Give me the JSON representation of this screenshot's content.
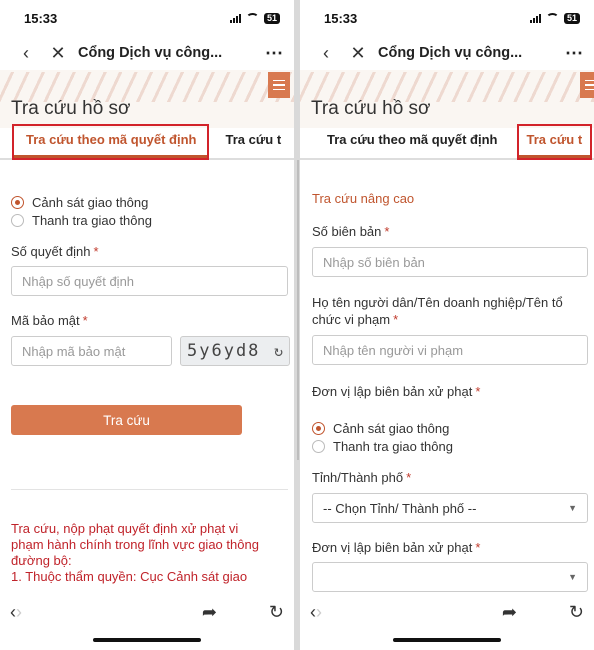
{
  "status": {
    "time": "15:33",
    "battery": "51"
  },
  "nav": {
    "back_icon": "chevron-left-icon",
    "close_icon": "close-icon",
    "title": "Cổng Dịch vụ công...",
    "more": "⋯"
  },
  "page": {
    "title": "Tra cứu hồ sơ"
  },
  "tabs": {
    "by_decision": "Tra cứu theo mã quyết định",
    "other_cut_left": "Tra cứu t",
    "other_cut_right": "Tra cứu t"
  },
  "agency_options": [
    "Cảnh sát giao thông",
    "Thanh tra giao thông"
  ],
  "left_form": {
    "decision_label": "Số quyết định",
    "decision_placeholder": "Nhập số quyết định",
    "security_label": "Mã bảo mật",
    "security_placeholder": "Nhập mã bảo mật",
    "captcha_text": "5y6yd8",
    "submit": "Tra cứu",
    "notice": [
      "Tra cứu, nộp phạt quyết định xử phạt vi",
      "phạm hành chính trong lĩnh vực giao thông",
      "đường bộ:",
      "1. Thuộc thẩm quyền: Cục Cảnh sát giao"
    ]
  },
  "right_form": {
    "section_title": "Tra cứu nâng cao",
    "record_label": "Số biên bản",
    "record_placeholder": "Nhập số biên bản",
    "violator_label_1": "Họ tên người dân/Tên doanh nghiệp/Tên tổ",
    "violator_label_2": "chức vi phạm",
    "violator_placeholder": "Nhập tên người vi phạm",
    "unit_label": "Đơn vị lập biên bản xử phạt",
    "province_label": "Tỉnh/Thành phố",
    "province_value": "-- Chọn Tỉnh/ Thành phố --",
    "unit_label_2": "Đơn vị lập biên bản xử phạt",
    "unit_value": ""
  },
  "required_mark": "*",
  "colors": {
    "accent": "#c0552e",
    "button": "#d8794f",
    "highlight_box": "#d2232a",
    "notice": "#c0232a"
  }
}
